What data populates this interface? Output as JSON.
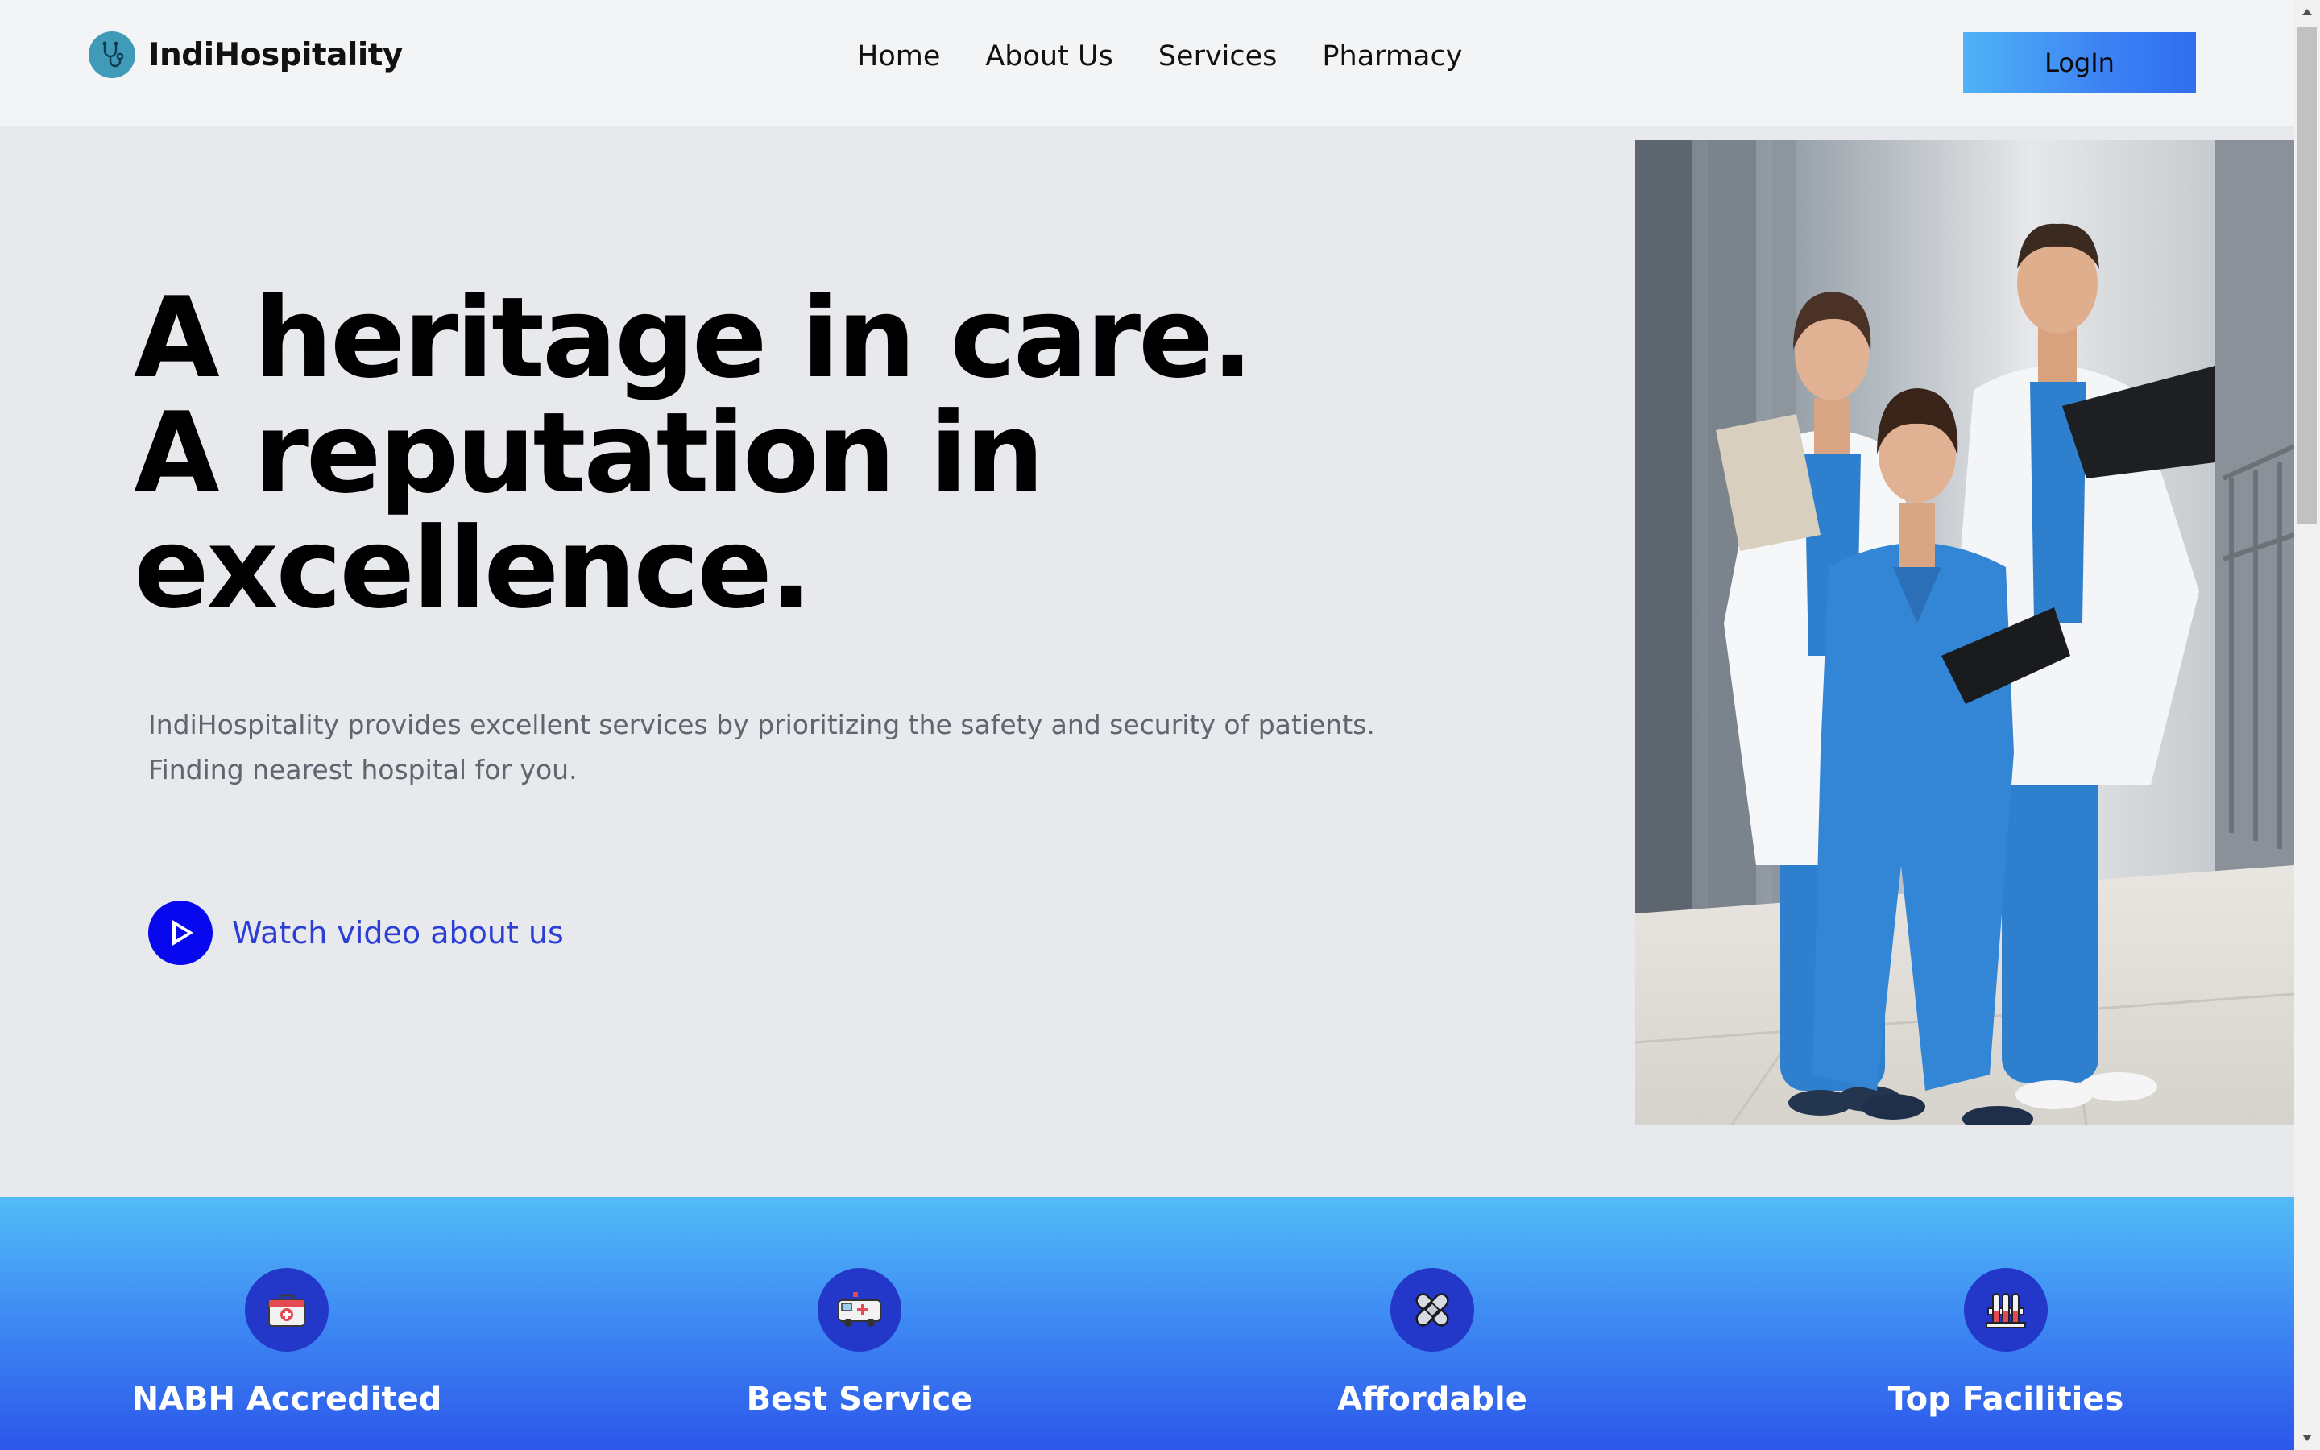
{
  "header": {
    "brand_name": "IndiHospitality",
    "logo_icon": "stethoscope-icon",
    "nav": [
      {
        "label": "Home"
      },
      {
        "label": "About Us"
      },
      {
        "label": "Services"
      },
      {
        "label": "Pharmacy"
      }
    ],
    "login_label": "LogIn"
  },
  "hero": {
    "title_lines": [
      "A heritage in care.",
      "A reputation in",
      "excellence."
    ],
    "description_lines": [
      "IndiHospitality provides excellent services by prioritizing the safety and security of patients.",
      "Finding nearest hospital for you."
    ],
    "watch_label": "Watch video about us",
    "watch_icon": "play-icon",
    "image_alt": "Three smiling medical staff in scrubs and white coats holding clipboards and an x-ray"
  },
  "features": [
    {
      "title": "NABH Accredited",
      "icon": "first-aid-kit-icon"
    },
    {
      "title": "Best Service",
      "icon": "ambulance-icon"
    },
    {
      "title": "Affordable",
      "icon": "bandage-icon"
    },
    {
      "title": "Top Facilities",
      "icon": "test-tubes-icon"
    }
  ],
  "colors": {
    "header_bg": "#f3f4f6",
    "page_bg": "#e8e9ec",
    "accent_blue": "#0808ee",
    "link_blue": "#2b3fd6",
    "features_gradient_top": "#52bcf7",
    "features_gradient_bottom": "#2c56ea",
    "feature_icon_bg": "#2338c9"
  }
}
